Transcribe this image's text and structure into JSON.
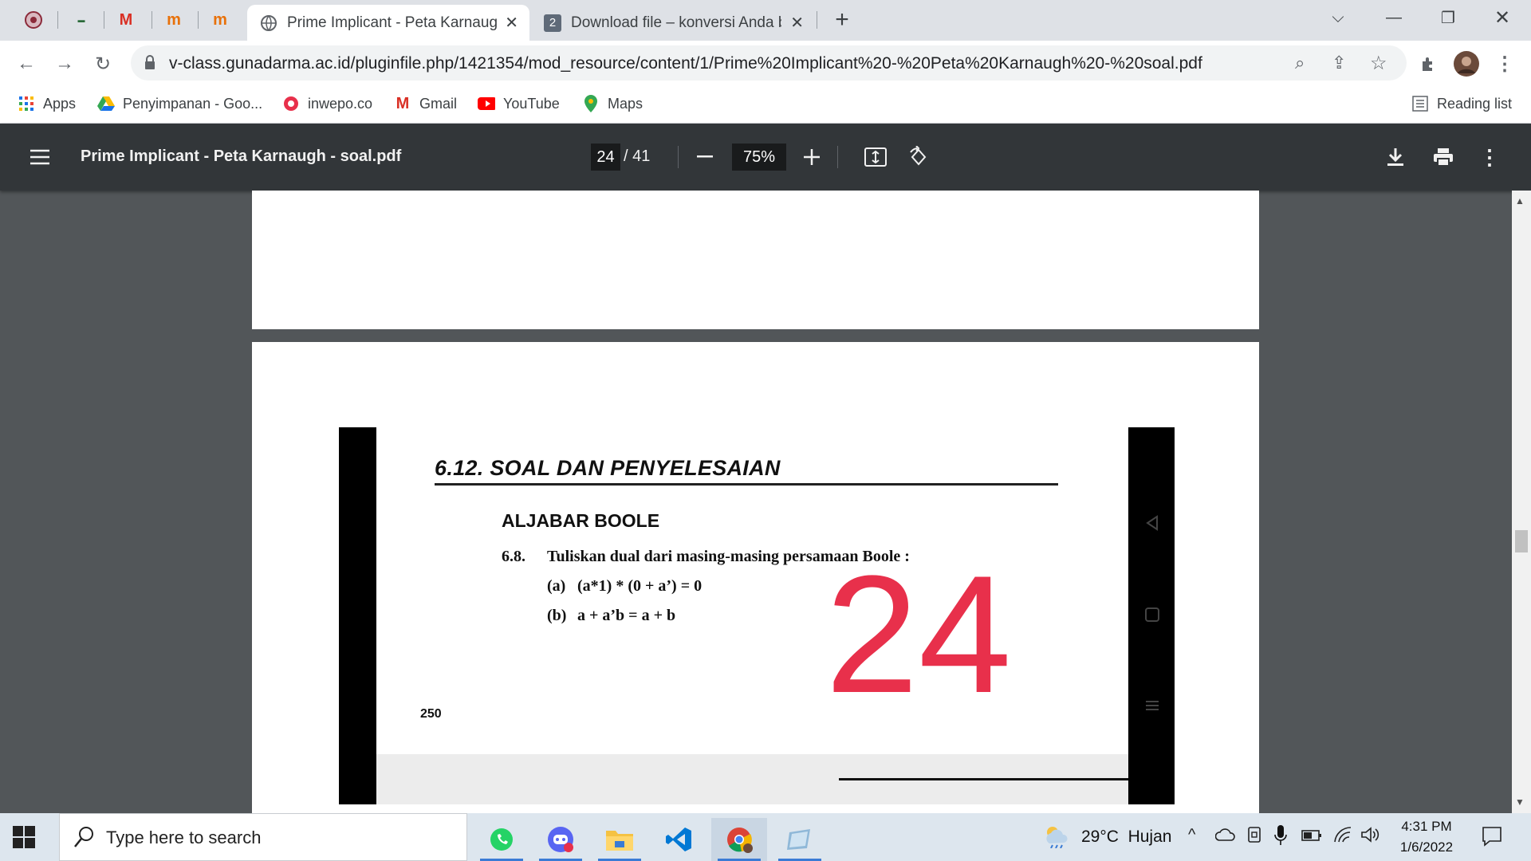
{
  "tabs": {
    "active_title": "Prime Implicant - Peta Karnaugh",
    "second_title": "Download file – konversi Anda be",
    "new_tab": "+"
  },
  "toolbar": {
    "url": "v-class.gunadarma.ac.id/pluginfile.php/1421354/mod_resource/content/1/Prime%20Implicant%20-%20Peta%20Karnaugh%20-%20soal.pdf"
  },
  "bookmarks": {
    "items": [
      "Apps",
      "Penyimpanan - Goo...",
      "inwepo.co",
      "Gmail",
      "YouTube",
      "Maps"
    ],
    "reading_list": "Reading list"
  },
  "pdf": {
    "title": "Prime Implicant - Peta Karnaugh - soal.pdf",
    "current_page": "24",
    "total_pages": "/ 41",
    "zoom": "75%"
  },
  "document": {
    "section_heading": "6.12. SOAL DAN PENYELESAIAN",
    "subheading": "ALJABAR BOOLE",
    "problem_number": "6.8.",
    "problem_text": "Tuliskan dual dari masing-masing persamaan Boole :",
    "part_a_label": "(a)",
    "part_a_expr": "(a*1) * (0 + a’) = 0",
    "part_b_label": "(b)",
    "part_b_expr": "a + a’b = a + b",
    "book_page_number": "250",
    "overlay_number": "24"
  },
  "taskbar": {
    "search_placeholder": "Type here to search",
    "weather": "29°C  Hujan",
    "time": "4:31 PM",
    "date": "1/6/2022"
  },
  "colors": {
    "accent_red": "#e8304b",
    "pdf_toolbar": "#323639",
    "viewer_bg": "#525659"
  }
}
